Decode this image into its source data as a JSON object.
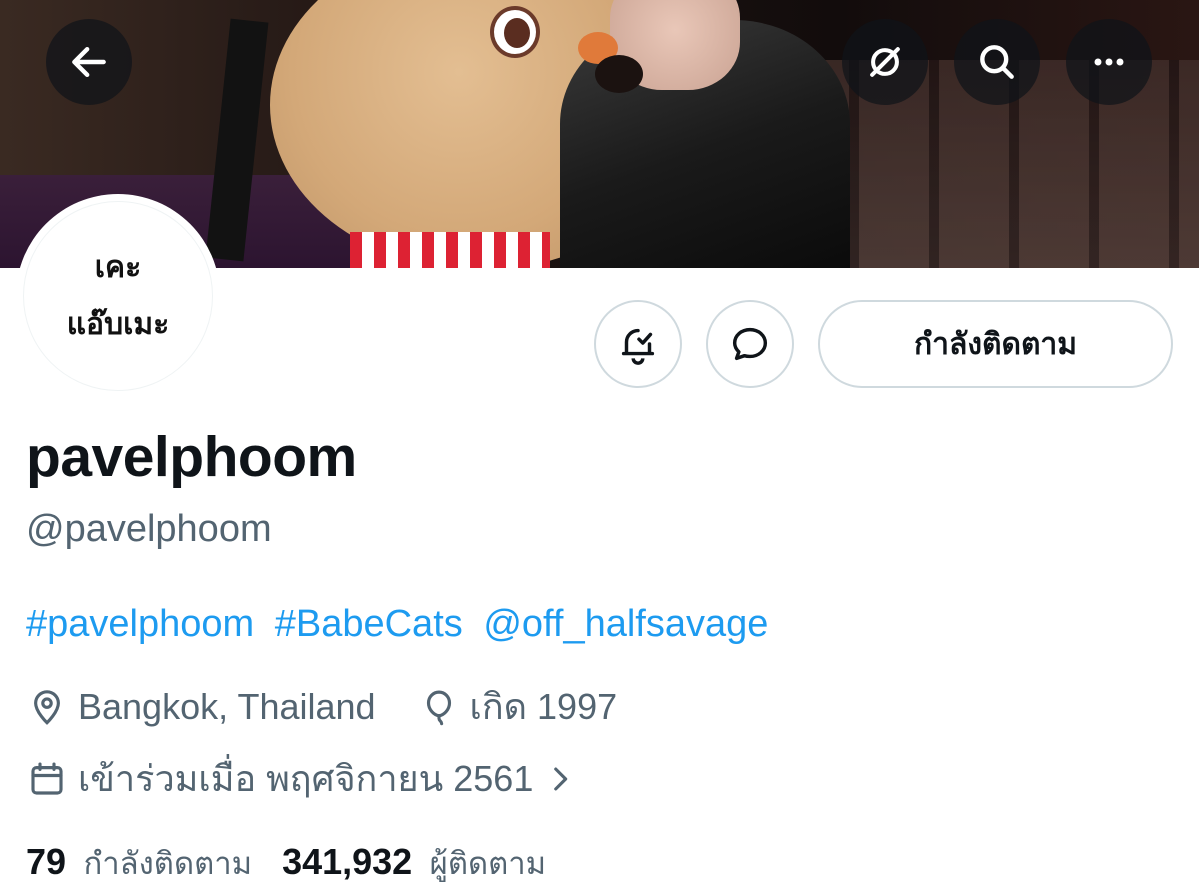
{
  "header": {
    "back_icon": "arrow-left-icon",
    "mute_icon": "translate-slash-icon",
    "search_icon": "search-icon",
    "more_icon": "more-horizontal-icon"
  },
  "avatar": {
    "line1": "เคะ",
    "line2": "แอ๊บเมะ"
  },
  "actions": {
    "notify_icon": "bell-check-icon",
    "message_icon": "chat-bubble-icon",
    "follow_label": "กำลังติดตาม"
  },
  "profile": {
    "display_name": "pavelphoom",
    "handle": "@pavelphoom",
    "bio_links": [
      "#pavelphoom",
      "#BabeCats",
      "@off_halfsavage"
    ],
    "location": "Bangkok, Thailand",
    "birth": "เกิด 1997",
    "joined": "เข้าร่วมเมื่อ พฤศจิกายน 2561"
  },
  "stats": {
    "following_count": "79",
    "following_label": "กำลังติดตาม",
    "followers_count": "341,932",
    "followers_label": "ผู้ติดตาม"
  },
  "colors": {
    "link": "#1d9bf0",
    "secondary_text": "#536471",
    "primary_text": "#0f1419",
    "border": "#cfd9de"
  }
}
